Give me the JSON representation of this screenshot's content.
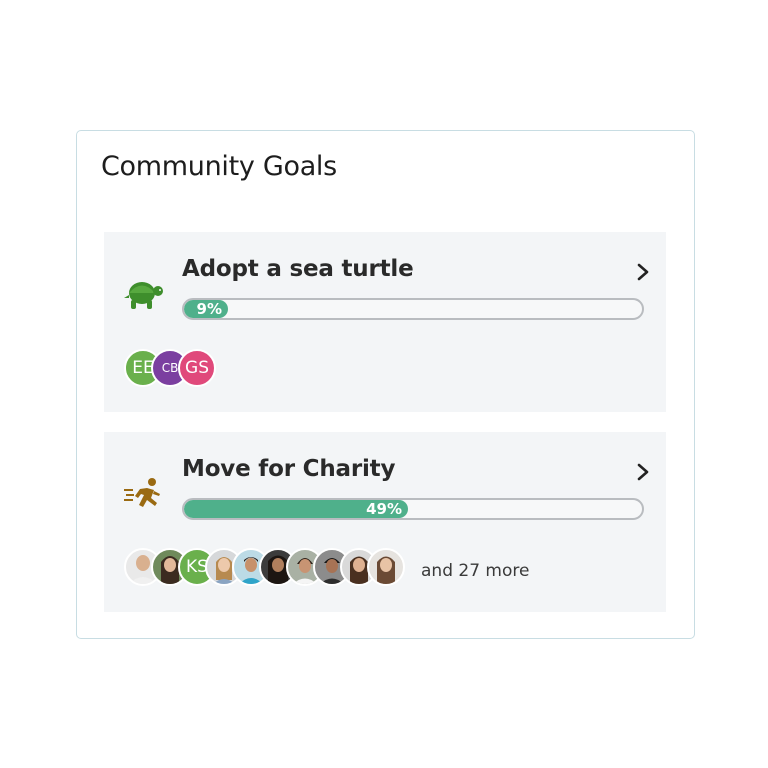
{
  "title": "Community Goals",
  "goals": [
    {
      "name": "Adopt a sea turtle",
      "icon": "turtle-icon",
      "progress_label": "9%",
      "progress": 0.09,
      "participants": [
        {
          "initials": "EE",
          "color": "#6ab04c"
        },
        {
          "initials": "CB",
          "color": "#7b3fa0"
        },
        {
          "initials": "GS",
          "color": "#e0497b"
        }
      ]
    },
    {
      "name": "Move for Charity",
      "icon": "runner-icon",
      "progress_label": "49%",
      "progress": 0.49,
      "participants": [
        {
          "type": "photo"
        },
        {
          "type": "photo"
        },
        {
          "initials": "KS",
          "color": "#6ab04c"
        },
        {
          "type": "photo"
        },
        {
          "type": "photo"
        },
        {
          "type": "photo"
        },
        {
          "type": "photo"
        },
        {
          "type": "photo"
        },
        {
          "type": "photo"
        },
        {
          "type": "photo"
        }
      ],
      "more_text": "and 27 more"
    }
  ],
  "colors": {
    "progress_fill": "#4fb08b",
    "turtle": "#3e8e2c",
    "runner": "#9a6a12"
  }
}
